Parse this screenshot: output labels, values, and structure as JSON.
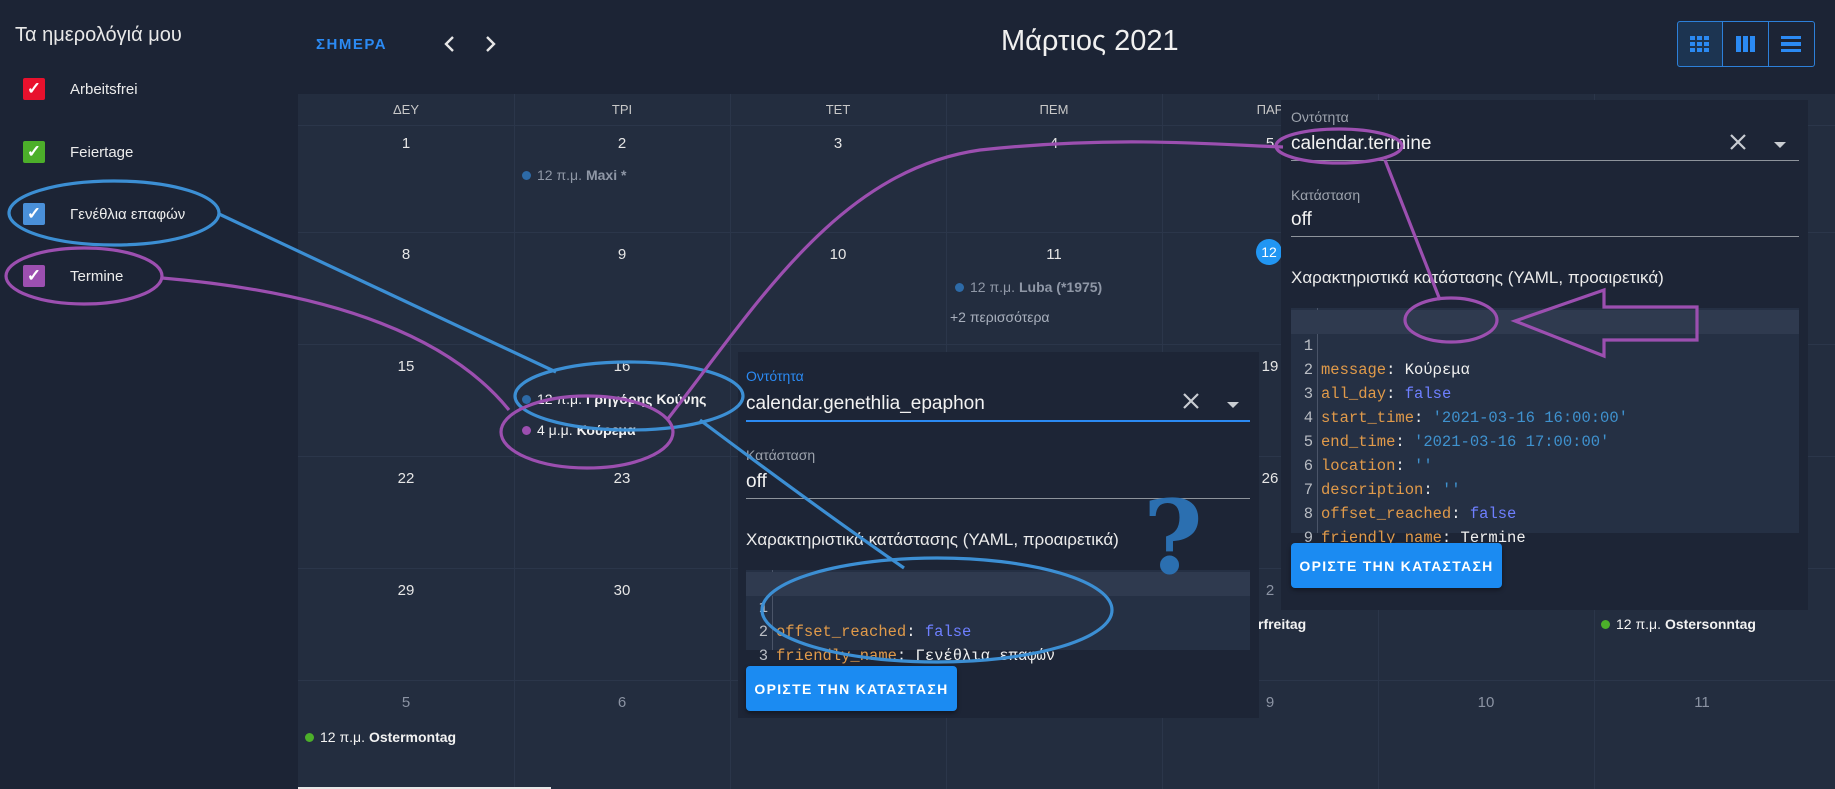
{
  "sidebar": {
    "title": "Τα ημερολόγιά μου",
    "calendars": [
      {
        "label": "Arbeitsfrei",
        "color": "#e8112d"
      },
      {
        "label": "Feiertage",
        "color": "#4caf2a"
      },
      {
        "label": "Γενέθλια επαφών",
        "color": "#4a90d9"
      },
      {
        "label": "Termine",
        "color": "#9c4fb0"
      }
    ]
  },
  "toolbar": {
    "today_label": "ΣΗΜΕΡΑ",
    "prev_icon": "chevron-left-icon",
    "next_icon": "chevron-right-icon",
    "month_title": "Μάρτιος 2021",
    "views": [
      "month-view-icon",
      "week-view-icon",
      "list-view-icon"
    ]
  },
  "weekdays": [
    "ΔΕΥ",
    "ΤΡΙ",
    "ΤΕΤ",
    "ΠΕΜ",
    "ΠΑΡ"
  ],
  "days": {
    "w1": [
      "1",
      "2",
      "3",
      "4",
      "5"
    ],
    "w2": [
      "8",
      "9",
      "10",
      "11",
      "12"
    ],
    "w3": [
      "15",
      "16",
      "19"
    ],
    "w4": [
      "22",
      "23",
      "26"
    ],
    "w5": [
      "29",
      "30",
      "2"
    ],
    "w6": [
      "5",
      "6",
      "9",
      "10",
      "11"
    ]
  },
  "events": {
    "maxi": {
      "time": "12 π.μ.",
      "title": "Maxi *",
      "color": "#2d6aa7"
    },
    "luba": {
      "time": "12 π.μ.",
      "title": "Luba (*1975)",
      "color": "#2d6aa7"
    },
    "more": "+2 περισσότερα",
    "gregoris": {
      "time": "12 π.μ.",
      "title": "Γρηγόρης Κούνης",
      "color": "#2d6aa7"
    },
    "koureme": {
      "time": "4 μ.μ.",
      "title": "Κούρεμα",
      "color": "#9c4fb0"
    },
    "karfreitag_tail": "rfreitag",
    "ostersonntag": {
      "time": "12 π.μ.",
      "title": "Ostersonntag",
      "color": "#4caf2a"
    },
    "ostermontag": {
      "time": "12 π.μ.",
      "title": "Ostermontag",
      "color": "#4caf2a"
    }
  },
  "popup_left": {
    "entity_label": "Οντότητα",
    "entity_value": "calendar.genethlia_epaphon",
    "state_label": "Κατάσταση",
    "state_value": "off",
    "attr_heading": "Χαρακτηριστικά κατάστασης (YAML, προαιρετικά)",
    "code": [
      {
        "n": "1",
        "key": "offset_reached",
        "value": "false",
        "kind": "bool"
      },
      {
        "n": "2",
        "key": "friendly_name",
        "value": "Γενέθλια επαφών",
        "kind": "plain"
      },
      {
        "n": "3",
        "key": "",
        "value": "",
        "kind": "plain"
      }
    ],
    "button": "ΟΡΙΣΤΕ ΤΗΝ ΚΑΤΑΣΤΑΣΗ"
  },
  "popup_right": {
    "entity_label": "Οντότητα",
    "entity_value": "calendar.termine",
    "state_label": "Κατάσταση",
    "state_value": "off",
    "attr_heading": "Χαρακτηριστικά κατάστασης (YAML, προαιρετικά)",
    "code": [
      {
        "n": "1",
        "key": "message",
        "value": "Κούρεμα",
        "kind": "plain"
      },
      {
        "n": "2",
        "key": "all_day",
        "value": "false",
        "kind": "bool"
      },
      {
        "n": "3",
        "key": "start_time",
        "value": "'2021-03-16 16:00:00'",
        "kind": "str"
      },
      {
        "n": "4",
        "key": "end_time",
        "value": "'2021-03-16 17:00:00'",
        "kind": "str"
      },
      {
        "n": "5",
        "key": "location",
        "value": "''",
        "kind": "str"
      },
      {
        "n": "6",
        "key": "description",
        "value": "''",
        "kind": "str"
      },
      {
        "n": "7",
        "key": "offset_reached",
        "value": "false",
        "kind": "bool"
      },
      {
        "n": "8",
        "key": "friendly_name",
        "value": "Termine",
        "kind": "plain"
      },
      {
        "n": "9",
        "key": "",
        "value": "",
        "kind": "plain"
      }
    ],
    "button": "ΟΡΙΣΤΕ ΤΗΝ ΚΑΤΑΣΤΑΣΗ"
  },
  "annotation": {
    "question_mark": "?",
    "blue": "#3c8fd4",
    "purple": "#9c4fb0"
  }
}
